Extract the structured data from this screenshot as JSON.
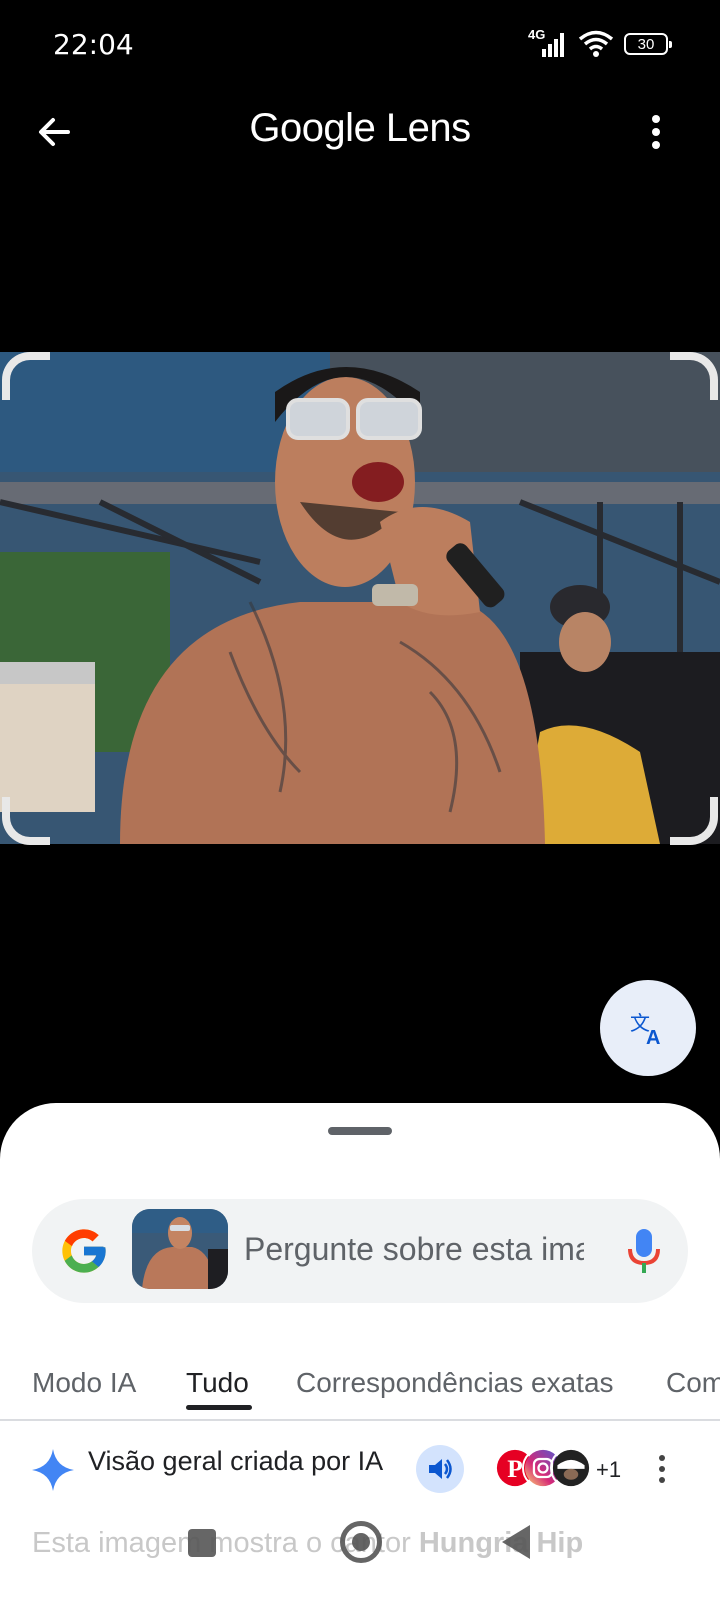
{
  "status_bar": {
    "time": "22:04",
    "network_type": "4G",
    "battery_level": "30",
    "icons": [
      "signal-icon",
      "wifi-icon",
      "battery-icon"
    ]
  },
  "app_bar": {
    "title": "Google Lens",
    "icons": [
      "back-arrow-icon",
      "more-vert-icon"
    ]
  },
  "image_view": {
    "icons": [
      "translate-icon"
    ]
  },
  "search": {
    "placeholder": "Pergunte sobre esta imagem",
    "icons": [
      "google-g-icon",
      "mic-icon"
    ]
  },
  "tabs": [
    {
      "label": "Modo IA",
      "active": false
    },
    {
      "label": "Tudo",
      "active": true
    },
    {
      "label": "Correspondências exatas",
      "active": false
    },
    {
      "label": "Compras",
      "active": false
    }
  ],
  "ai_overview": {
    "title": "Visão geral criada por IA",
    "sources_extra": "+1",
    "source_icons": [
      "pinterest-icon",
      "instagram-icon",
      "profile-icon"
    ],
    "answer_prefix": "Esta imagem mostra o cantor ",
    "answer_bold": "Hungria Hip"
  },
  "nav_bar": {
    "icons": [
      "recents-icon",
      "home-icon",
      "back-icon"
    ]
  },
  "colors": {
    "background": "#000000",
    "sheet": "#ffffff",
    "search_bg": "#f1f3f4",
    "accent_blue": "#4285f4",
    "speaker_bg": "#d3e3fd"
  }
}
